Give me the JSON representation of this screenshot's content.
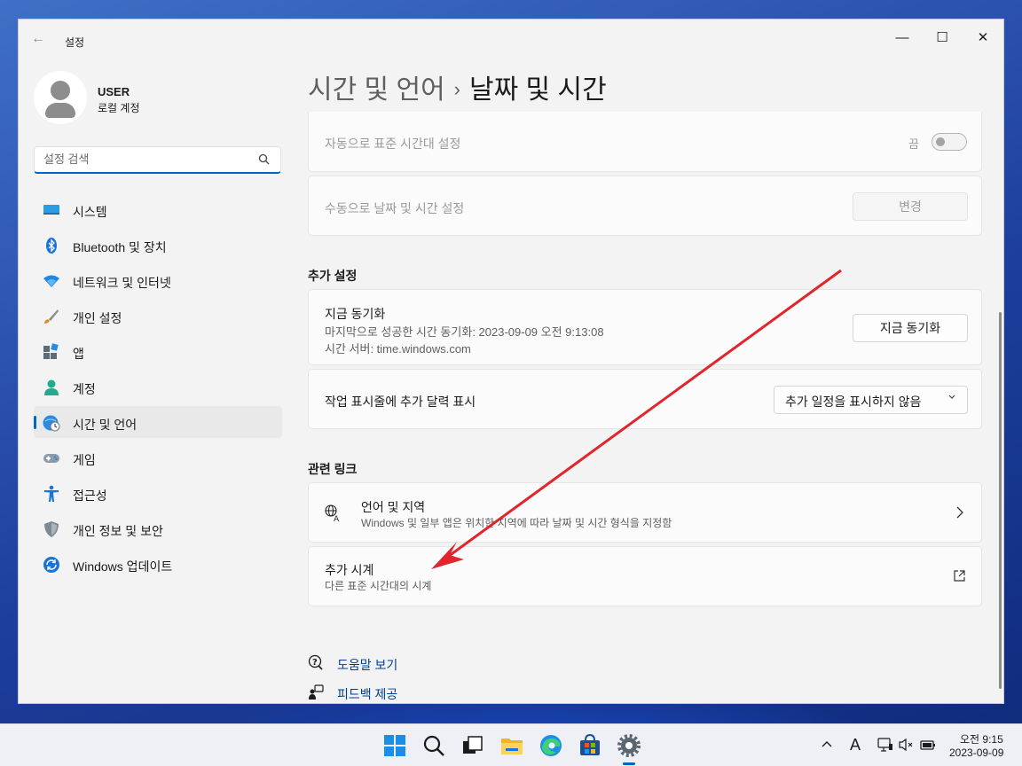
{
  "window": {
    "title": "설정",
    "controls": {
      "minimize": "—",
      "maximize": "☐",
      "close": "✕"
    }
  },
  "user": {
    "name": "USER",
    "account_type": "로컬 계정"
  },
  "search": {
    "placeholder": "설정 검색"
  },
  "sidebar": {
    "items": [
      {
        "label": "시스템",
        "icon": "system-icon"
      },
      {
        "label": "Bluetooth 및 장치",
        "icon": "bluetooth-icon"
      },
      {
        "label": "네트워크 및 인터넷",
        "icon": "wifi-icon"
      },
      {
        "label": "개인 설정",
        "icon": "brush-icon"
      },
      {
        "label": "앱",
        "icon": "apps-icon"
      },
      {
        "label": "계정",
        "icon": "account-icon"
      },
      {
        "label": "시간 및 언어",
        "icon": "time-language-icon",
        "active": true
      },
      {
        "label": "게임",
        "icon": "gamepad-icon"
      },
      {
        "label": "접근성",
        "icon": "accessibility-icon"
      },
      {
        "label": "개인 정보 및 보안",
        "icon": "shield-icon"
      },
      {
        "label": "Windows 업데이트",
        "icon": "update-icon"
      }
    ]
  },
  "breadcrumb": {
    "parent": "시간 및 언어",
    "separator": "›",
    "current": "날짜 및 시간"
  },
  "settings": {
    "auto_timezone": {
      "label": "자동으로 표준 시간대 설정",
      "state": "끔"
    },
    "manual_datetime": {
      "label": "수동으로 날짜 및 시간 설정",
      "button": "변경"
    }
  },
  "additional": {
    "heading": "추가 설정",
    "sync": {
      "title": "지금 동기화",
      "last_sync": "마지막으로 성공한 시간 동기화: 2023-09-09 오전 9:13:08",
      "server": "시간 서버: time.windows.com",
      "button": "지금 동기화"
    },
    "calendar": {
      "label": "작업 표시줄에 추가 달력 표시",
      "selected": "추가 일정을 표시하지 않음"
    }
  },
  "related": {
    "heading": "관련 링크",
    "language": {
      "title": "언어 및 지역",
      "subtitle": "Windows 및 일부 앱은 위치한 지역에 따라 날짜 및 시간 형식을 지정함"
    },
    "clocks": {
      "title": "추가 시계",
      "subtitle": "다른 표준 시간대의 시계"
    }
  },
  "help": {
    "get_help": "도움말 보기",
    "feedback": "피드백 제공"
  },
  "taskbar": {
    "ime": "A",
    "time": "오전 9:15",
    "date": "2023-09-09"
  },
  "colors": {
    "accent": "#0067c0",
    "annotation_arrow": "#e0262c"
  }
}
